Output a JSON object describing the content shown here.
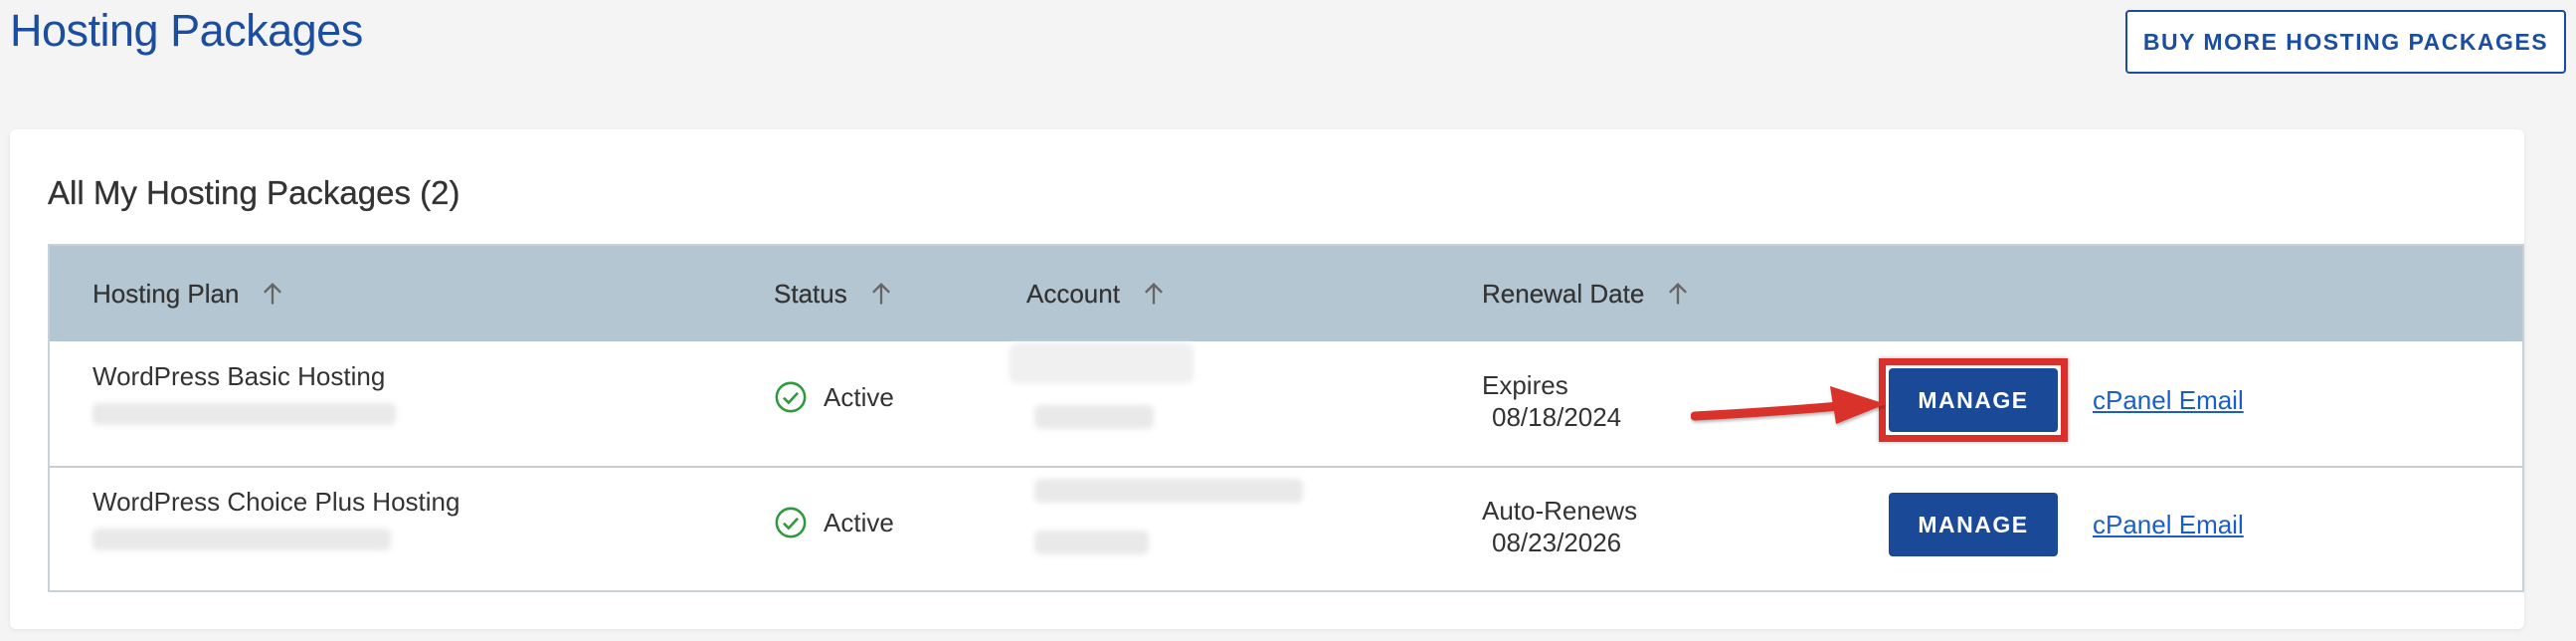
{
  "page": {
    "title": "Hosting Packages",
    "buy_more_label": "BUY MORE HOSTING PACKAGES"
  },
  "card": {
    "title": "All My Hosting Packages (2)"
  },
  "table": {
    "columns": [
      {
        "label": "Hosting Plan"
      },
      {
        "label": "Status"
      },
      {
        "label": "Account"
      },
      {
        "label": "Renewal Date"
      }
    ],
    "rows": [
      {
        "plan": "WordPress Basic Hosting",
        "status": "Active",
        "renewal_label": "Expires",
        "renewal_date": "08/18/2024",
        "manage_label": "MANAGE",
        "cpanel_label": "cPanel Email"
      },
      {
        "plan": "WordPress Choice Plus Hosting",
        "status": "Active",
        "renewal_label": "Auto-Renews",
        "renewal_date": "08/23/2026",
        "manage_label": "MANAGE",
        "cpanel_label": "cPanel Email"
      }
    ]
  },
  "colors": {
    "brand_blue": "#1b4ea0",
    "header_bg": "#b3c6d2",
    "active_green": "#2e9a3e",
    "annotation_red": "#d9302b"
  },
  "icons": {
    "sort": "arrow-up-icon",
    "status": "check-circle-icon",
    "annotation": "red-arrow-annotation"
  }
}
